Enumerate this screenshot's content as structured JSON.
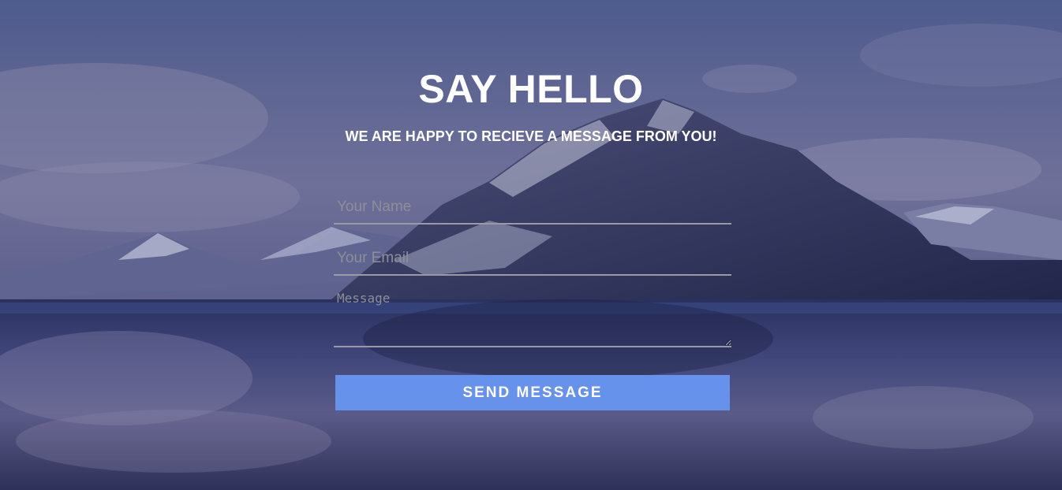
{
  "contact": {
    "title": "SAY HELLO",
    "subtitle": "WE ARE HAPPY TO RECIEVE A MESSAGE FROM YOU!",
    "name_placeholder": "Your Name",
    "email_placeholder": "Your Email",
    "message_placeholder": "Message",
    "send_label": "SEND MESSAGE"
  },
  "colors": {
    "button": "#6692ec",
    "text": "#ffffff",
    "field_underline": "#9a9aa3"
  }
}
